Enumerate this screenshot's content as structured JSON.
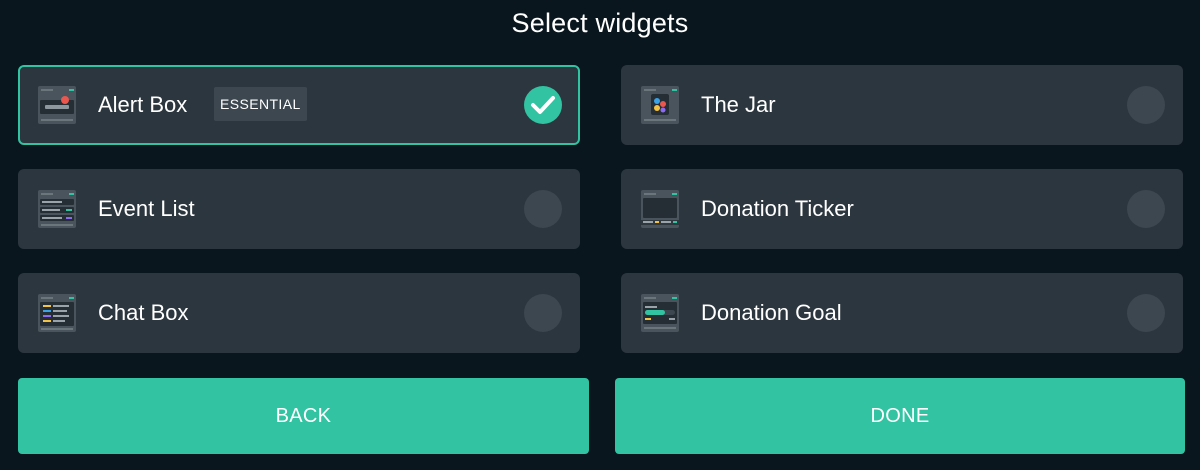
{
  "header": {
    "title": "Select widgets"
  },
  "widgets": [
    {
      "label": "Alert Box",
      "badge": "ESSENTIAL",
      "selected": true,
      "icon": "alert-box-icon"
    },
    {
      "label": "The Jar",
      "selected": false,
      "icon": "jar-icon"
    },
    {
      "label": "Event List",
      "selected": false,
      "icon": "event-list-icon"
    },
    {
      "label": "Donation Ticker",
      "selected": false,
      "icon": "donation-ticker-icon"
    },
    {
      "label": "Chat Box",
      "selected": false,
      "icon": "chat-box-icon"
    },
    {
      "label": "Donation Goal",
      "selected": false,
      "icon": "donation-goal-icon"
    }
  ],
  "footer": {
    "back_label": "BACK",
    "done_label": "DONE"
  },
  "colors": {
    "background": "#09161d",
    "card": "#2c363e",
    "accent": "#31c3a2",
    "radio_off": "#3d474f"
  }
}
